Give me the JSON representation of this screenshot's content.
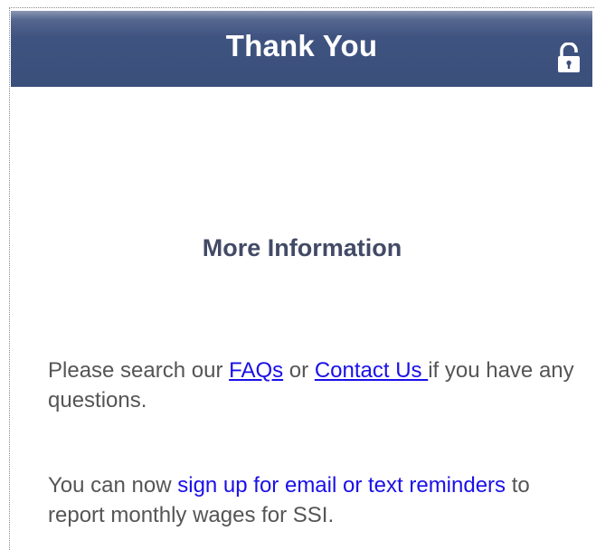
{
  "header": {
    "title": "Thank You",
    "lock_icon": "unlocked-padlock-icon",
    "background_color": "#3f5380"
  },
  "section": {
    "title": "More Information"
  },
  "faq_paragraph": {
    "text_before": "Please search our ",
    "faq_link": "FAQs",
    "text_or": " or ",
    "contact_link": "Contact Us ",
    "text_after": "if you have any questions."
  },
  "reminder_paragraph": {
    "text_before": "You can now ",
    "signup_link": "sign up for email or text reminders",
    "text_after": " to report monthly wages for SSI."
  },
  "colors": {
    "link": "#1a10e8",
    "body_text": "#555555",
    "heading": "#424a66"
  }
}
